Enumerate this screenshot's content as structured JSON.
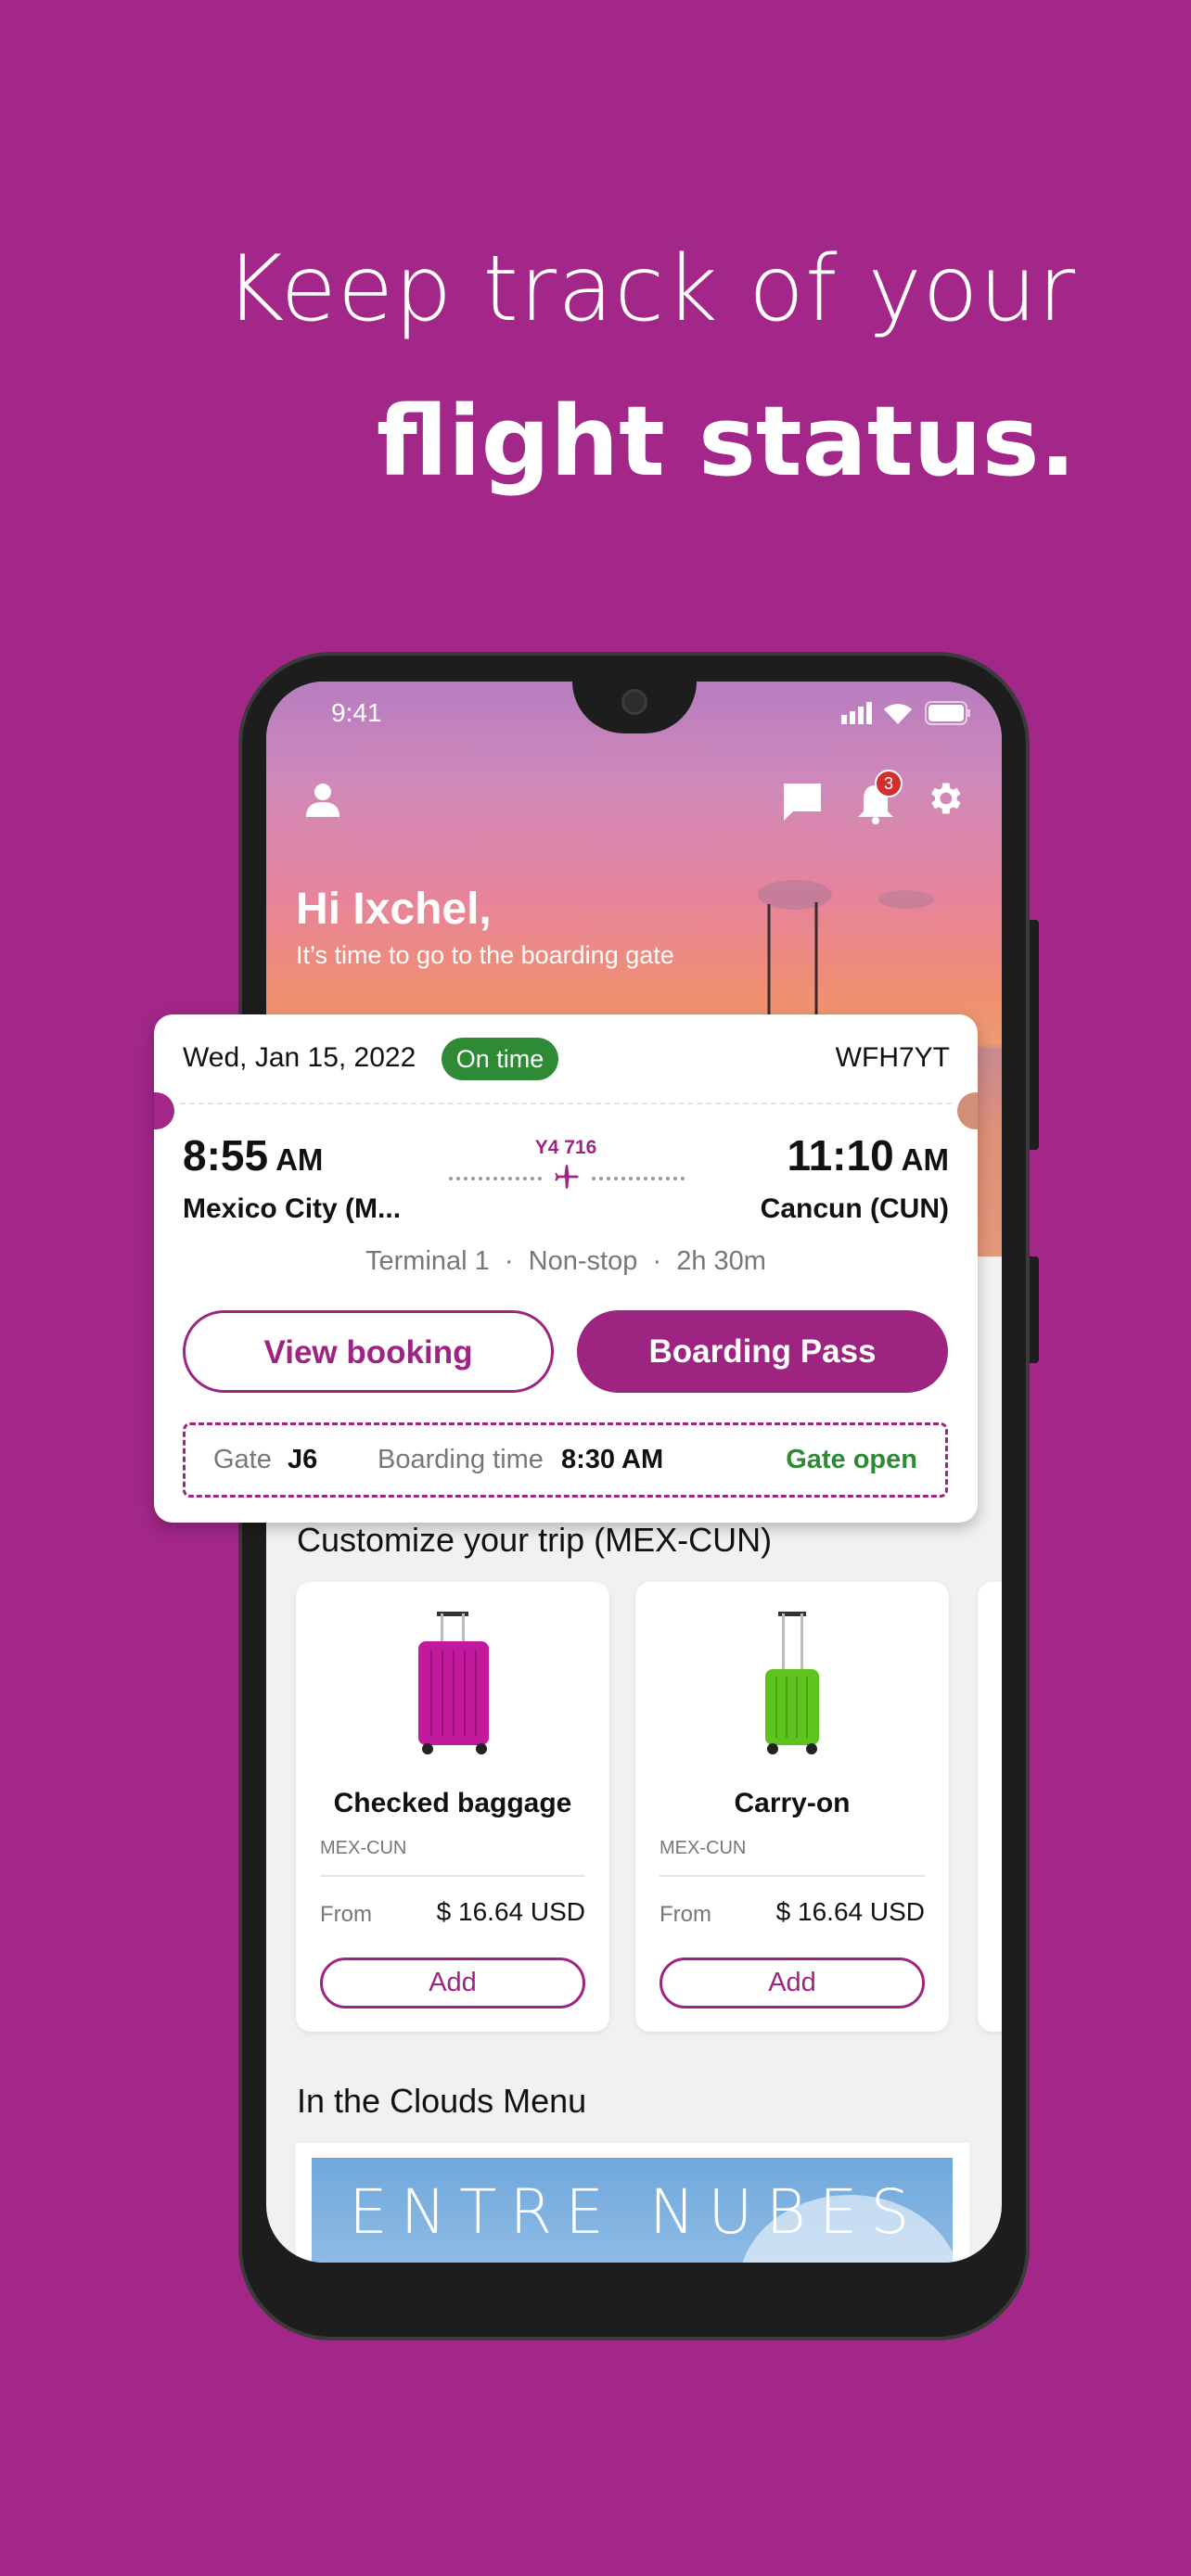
{
  "headline": {
    "line1": "Keep track of your",
    "line2": "flight status."
  },
  "status_bar": {
    "time": "9:41"
  },
  "header": {
    "notification_count": "3",
    "greeting": "Hi Ixchel,",
    "subtitle": "It’s time to go to the boarding gate"
  },
  "flight_card": {
    "date": "Wed, Jan 15, 2022",
    "status": "On time",
    "confirmation_code": "WFH7YT",
    "departure_time": "8:55",
    "departure_ampm": "AM",
    "departure_city": "Mexico City (M...",
    "arrival_time": "11:10",
    "arrival_ampm": "AM",
    "arrival_city": "Cancun (CUN)",
    "flight_number": "Y4 716",
    "details": "Terminal 1  ·  Non-stop  ·  2h 30m",
    "view_booking_label": "View booking",
    "boarding_pass_label": "Boarding Pass",
    "gate_label": "Gate",
    "gate_value": "J6",
    "boarding_time_label": "Boarding time",
    "boarding_time_value": "8:30 AM",
    "gate_status": "Gate open"
  },
  "customize": {
    "title": "Customize your trip (MEX-CUN)",
    "products": [
      {
        "name": "Checked baggage",
        "route": "MEX-CUN",
        "from_label": "From",
        "price": "$ 16.64 USD",
        "add_label": "Add",
        "color": "#c21a9c"
      },
      {
        "name": "Carry-on",
        "route": "MEX-CUN",
        "from_label": "From",
        "price": "$ 16.64 USD",
        "add_label": "Add",
        "color": "#5ec21f"
      }
    ]
  },
  "menu": {
    "title": "In the Clouds Menu",
    "banner_text": "ENTRE NUBES"
  },
  "colors": {
    "background": "#a22788",
    "primary": "#9e2482",
    "on_time": "#2f8a35",
    "badge": "#d32f2f"
  }
}
